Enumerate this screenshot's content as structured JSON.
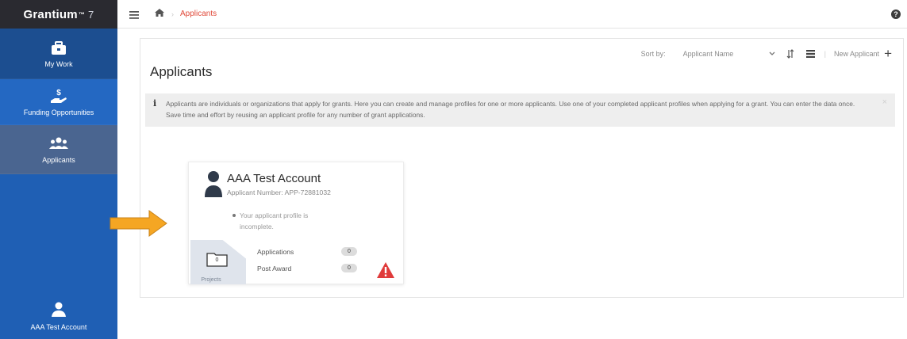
{
  "app": {
    "brand": "Grantium",
    "brand_tm": "™",
    "version": "7"
  },
  "sidebar": {
    "items": [
      {
        "label": "My Work",
        "icon": "briefcase-icon"
      },
      {
        "label": "Funding Opportunities",
        "icon": "hand-dollar-icon"
      },
      {
        "label": "Applicants",
        "icon": "users-group-icon"
      }
    ],
    "account": {
      "label": "AAA Test Account",
      "icon": "user-icon"
    }
  },
  "breadcrumb": {
    "home_icon": "home-icon",
    "separator": "›",
    "current": "Applicants"
  },
  "help": {
    "label": "?"
  },
  "page": {
    "title": "Applicants",
    "sort_label": "Sort by:",
    "sort_value": "Applicant Name",
    "new_applicant": "New Applicant",
    "new_applicant_plus": "+",
    "info_icon": "i",
    "info_text": "Applicants are individuals or organizations that apply for grants. Here you can create and manage profiles for one or more applicants. Use one of your completed applicant profiles when applying for a grant. You can enter the data once. Save time and effort by reusing an applicant profile for any number of grant applications.",
    "info_close": "×"
  },
  "card": {
    "name": "AAA Test Account",
    "number": "Applicant Number: APP-72881032",
    "status_note": "Your applicant profile is incomplete.",
    "folder_count": "0",
    "folder_label": "Projects",
    "applications_label": "Applications",
    "applications_count": "0",
    "post_award_label": "Post Award",
    "post_award_count": "0"
  },
  "colors": {
    "sidebar": "#1f5fb4",
    "brand_bar": "#2a2a30",
    "active_item": "#4a6590",
    "breadcrumb_current": "#e04a3a",
    "warning": "#e03b3b",
    "annotation_arrow": "#f5a623"
  }
}
